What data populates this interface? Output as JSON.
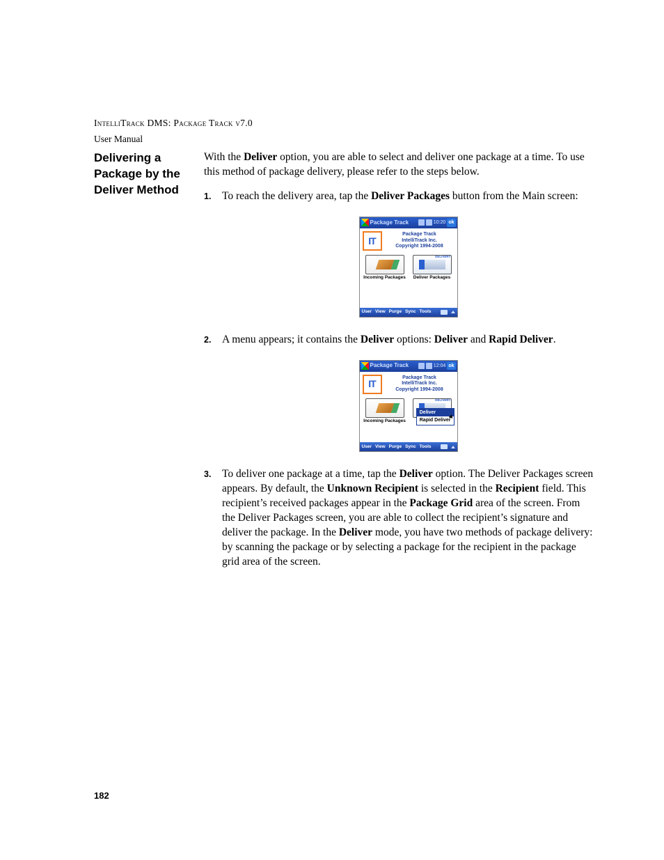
{
  "header": {
    "product_line": "IntelliTrack DMS: Package Track v7.0",
    "doc_type": "User Manual"
  },
  "side_heading": "Delivering a Package by the Deliver Method",
  "intro": {
    "pre": "With the ",
    "b1": "Deliver",
    "post": " option, you are able to select and deliver one package at a time. To use this method of package delivery, please refer to the steps below."
  },
  "steps": {
    "s1": {
      "num": "1.",
      "pre": "To reach the delivery area, tap the ",
      "b1": "Deliver Packages",
      "post": " button from the Main screen:"
    },
    "s2": {
      "num": "2.",
      "pre": "A menu appears; it contains the ",
      "b1": "Deliver",
      "mid": " options: ",
      "b2": "Deliver",
      "and": " and ",
      "b3": "Rapid Deliver",
      "post": "."
    },
    "s3": {
      "num": "3.",
      "t1": "To deliver one package at a time, tap the ",
      "b1": "Deliver",
      "t2": " option. The Deliver Packages screen appears. By default, the ",
      "b2": "Unknown Recipient",
      "t3": " is selected in the ",
      "b3": "Recipient",
      "t4": " field. This recipient’s received packages appear in the ",
      "b4": "Package Grid",
      "t5": " area of the screen. From the Deliver Packages screen, you are able to collect the recipient’s signature and deliver the package. In the ",
      "b5": "Deliver",
      "t6": " mode, you have two methods of package delivery: by scanning the package or by selecting a package for the recipient in the package grid area of the screen."
    }
  },
  "pda": {
    "title": "Package Track",
    "ok": "ok",
    "app_name": "Package Track",
    "company": "IntelliTrack Inc.",
    "copyright": "Copyright 1994-2008",
    "btn_incoming": "Incoming Packages",
    "btn_deliver": "Deliver Packages",
    "time1": "10:20",
    "time2": "12:04",
    "menu": {
      "m1": "User",
      "m2": "View",
      "m3": "Purge",
      "m4": "Sync",
      "m5": "Tools"
    },
    "popup": {
      "i1": "Deliver",
      "i2": "Rapid Deliver"
    }
  },
  "page_number": "182"
}
